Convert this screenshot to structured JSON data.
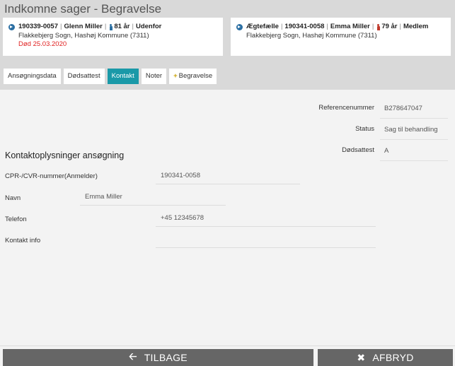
{
  "page_title": "Indkomne sager - Begravelse",
  "cards": {
    "deceased": {
      "cpr": "190339-0057",
      "name": "Glenn Miller",
      "age": "81 år",
      "status": "Udenfor",
      "parish": "Flakkebjerg Sogn, Hashøj Kommune (7311)",
      "death": "Død 25.03.2020"
    },
    "spouse": {
      "relation": "Ægtefælle",
      "cpr": "190341-0058",
      "name": "Emma Miller",
      "age": "79 år",
      "status": "Medlem",
      "parish": "Flakkebjerg Sogn, Hashøj Kommune (7311)"
    }
  },
  "tabs": [
    {
      "label": "Ansøgningsdata",
      "active": false
    },
    {
      "label": "Dødsattest",
      "active": false
    },
    {
      "label": "Kontakt",
      "active": true
    },
    {
      "label": "Noter",
      "active": false
    },
    {
      "label": "Begravelse",
      "active": false
    }
  ],
  "info": {
    "reference_label": "Referencenummer",
    "reference_value": "B278647047",
    "status_label": "Status",
    "status_value": "Sag til behandling",
    "death_cert_label": "Dødsattest",
    "death_cert_value": "A"
  },
  "contact": {
    "section_title": "Kontaktoplysninger ansøgning",
    "cpr_label": "CPR-/CVR-nummer(Anmelder)",
    "cpr_value": "190341-0058",
    "name_label": "Navn",
    "name_value": "Emma Miller",
    "phone_label": "Telefon",
    "phone_value": "+45 12345678",
    "info_label": "Kontakt info",
    "info_value": ""
  },
  "footer": {
    "back_label": "TILBAGE",
    "cancel_label": "AFBRYD"
  },
  "colors": {
    "accent": "#1a99a8",
    "death_red": "#e02020",
    "button": "#666666"
  }
}
